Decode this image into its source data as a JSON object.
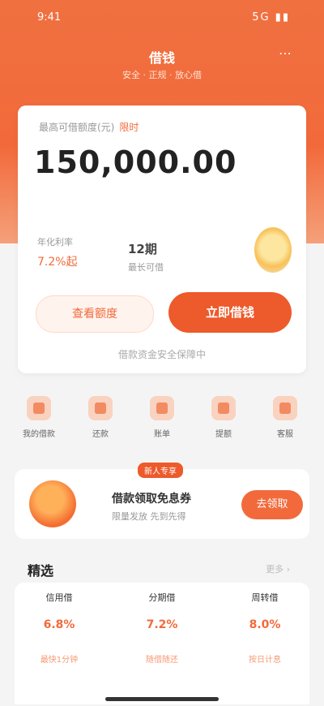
{
  "status": {
    "time": "9:41",
    "right": "5G ▮▮"
  },
  "nav": {
    "title": "借钱",
    "more": "⋯",
    "subtitle": "安全 · 正规 · 放心借"
  },
  "card": {
    "label": "最高可借额度(元)",
    "label_tag": "限时",
    "amount": "150,000.00",
    "rate_label": "年化利率",
    "rate_value": "7.2%起",
    "term_value": "12期",
    "term_label": "最长可借",
    "secondary_button": "查看额度",
    "primary_button": "立即借钱",
    "note": "借款资金安全保障中"
  },
  "tools": [
    {
      "label": "我的借款",
      "icon": "wallet-icon"
    },
    {
      "label": "还款",
      "icon": "repay-icon"
    },
    {
      "label": "账单",
      "icon": "bill-icon"
    },
    {
      "label": "提额",
      "icon": "raise-icon"
    },
    {
      "label": "客服",
      "icon": "service-icon"
    }
  ],
  "promo": {
    "tag": "新人专享",
    "text": "借款领取免息券",
    "sub": "限量发放 先到先得",
    "button": "去领取"
  },
  "section": {
    "title": "精选",
    "more": "更多 ›"
  },
  "products": [
    {
      "name": "信用借",
      "rate": "6.8%",
      "desc": "最快1分钟"
    },
    {
      "name": "分期借",
      "rate": "7.2%",
      "desc": "随借随还"
    },
    {
      "name": "周转借",
      "rate": "8.0%",
      "desc": "按日计息"
    }
  ],
  "colors": {
    "brand": "#f26a3b",
    "brand_dark": "#ed5a2c",
    "background": "#f4f4f4"
  }
}
